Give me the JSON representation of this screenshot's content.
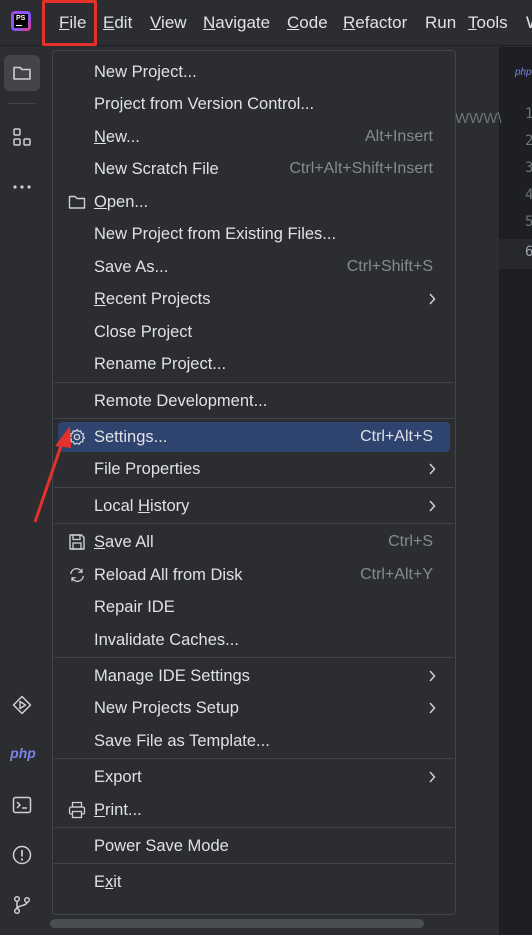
{
  "menubar": {
    "items": [
      {
        "label": "File",
        "mnemonic": "F",
        "rest": "ile"
      },
      {
        "label": "Edit",
        "mnemonic": "E",
        "rest": "dit"
      },
      {
        "label": "View",
        "mnemonic": "V",
        "rest": "iew"
      },
      {
        "label": "Navigate",
        "mnemonic": "N",
        "rest": "avigate"
      },
      {
        "label": "Code",
        "mnemonic": "C",
        "rest": "ode"
      },
      {
        "label": "Refactor",
        "mnemonic": "R",
        "rest": "efactor"
      },
      {
        "label": "Run",
        "mnemonic": "",
        "rest": "Run"
      },
      {
        "label": "Tools",
        "mnemonic": "T",
        "rest": "ools"
      },
      {
        "label": "W",
        "mnemonic": "W",
        "rest": ""
      }
    ],
    "logo_text": "PS"
  },
  "file_menu": {
    "items": [
      {
        "label": "New Project...",
        "shortcut": ""
      },
      {
        "label": "Project from Version Control...",
        "shortcut": ""
      },
      {
        "label": "New...",
        "pre": "",
        "u": "N",
        "post": "ew...",
        "shortcut": "Alt+Insert"
      },
      {
        "label": "New Scratch File",
        "shortcut": "Ctrl+Alt+Shift+Insert"
      },
      {
        "label": "Open...",
        "pre": "",
        "u": "O",
        "post": "pen...",
        "shortcut": "",
        "icon": "folder-icon"
      },
      {
        "label": "New Project from Existing Files...",
        "shortcut": ""
      },
      {
        "label": "Save As...",
        "shortcut": "Ctrl+Shift+S"
      },
      {
        "label": "Recent Projects",
        "pre": "",
        "u": "R",
        "post": "ecent Projects",
        "shortcut": "",
        "submenu": true
      },
      {
        "label": "Close Project",
        "shortcut": ""
      },
      {
        "label": "Rename Project...",
        "shortcut": ""
      },
      {
        "label": "Remote Development...",
        "shortcut": ""
      },
      {
        "label": "Settings...",
        "shortcut": "Ctrl+Alt+S",
        "icon": "gear-icon",
        "selected": true
      },
      {
        "label": "File Properties",
        "shortcut": "",
        "submenu": true
      },
      {
        "label": "Local History",
        "pre": "Local ",
        "u": "H",
        "post": "istory",
        "shortcut": "",
        "submenu": true
      },
      {
        "label": "Save All",
        "pre": "",
        "u": "S",
        "post": "ave All",
        "shortcut": "Ctrl+S",
        "icon": "save-icon"
      },
      {
        "label": "Reload All from Disk",
        "shortcut": "Ctrl+Alt+Y",
        "icon": "reload-icon"
      },
      {
        "label": "Repair IDE",
        "shortcut": ""
      },
      {
        "label": "Invalidate Caches...",
        "shortcut": ""
      },
      {
        "label": "Manage IDE Settings",
        "shortcut": "",
        "submenu": true
      },
      {
        "label": "New Projects Setup",
        "shortcut": "",
        "submenu": true
      },
      {
        "label": "Save File as Template...",
        "shortcut": ""
      },
      {
        "label": "Export",
        "shortcut": "",
        "submenu": true
      },
      {
        "label": "Print...",
        "pre": "",
        "u": "P",
        "post": "rint...",
        "shortcut": "",
        "icon": "printer-icon"
      },
      {
        "label": "Power Save Mode",
        "shortcut": ""
      },
      {
        "label": "Exit",
        "pre": "E",
        "u": "x",
        "post": "it",
        "shortcut": ""
      }
    ]
  },
  "left_toolbar": {
    "php_label": "php"
  },
  "editor": {
    "tab_label": "php",
    "ghost_text": "WWW\\",
    "line_numbers": [
      "1",
      "2",
      "3",
      "4",
      "5",
      "6"
    ]
  },
  "colors": {
    "background": "#2b2d30",
    "selected_item": "#2e436e",
    "highlight_box": "#e5302b",
    "annotation_arrow": "#e5302b"
  }
}
